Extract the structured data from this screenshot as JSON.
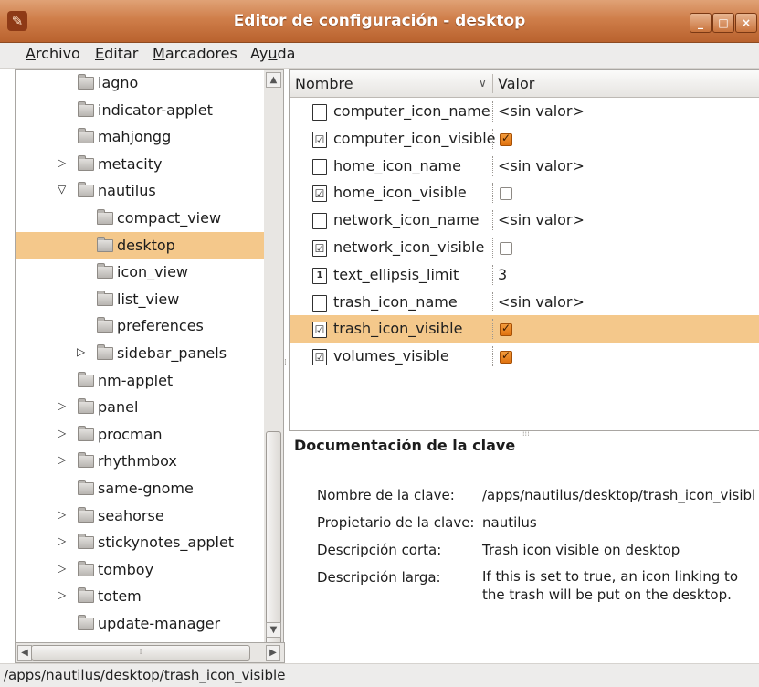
{
  "window": {
    "title": "Editor de configuración - desktop",
    "minimize": "_",
    "maximize": "□",
    "close": "×"
  },
  "menubar": [
    {
      "label": "Archivo",
      "mnemonic": "A",
      "rest": "rchivo"
    },
    {
      "label": "Editar",
      "mnemonic": "E",
      "rest": "ditar"
    },
    {
      "label": "Marcadores",
      "mnemonic": "M",
      "rest": "arcadores"
    },
    {
      "label": "Ayuda",
      "pre": "Ay",
      "mnemonic": "u",
      "rest": "da"
    }
  ],
  "tree": {
    "items": [
      {
        "label": "iagno",
        "expander": ""
      },
      {
        "label": "indicator-applet",
        "expander": ""
      },
      {
        "label": "mahjongg",
        "expander": ""
      },
      {
        "label": "metacity",
        "expander": "▷"
      },
      {
        "label": "nautilus",
        "expander": "▽"
      },
      {
        "label": "compact_view",
        "expander": ""
      },
      {
        "label": "desktop",
        "expander": ""
      },
      {
        "label": "icon_view",
        "expander": ""
      },
      {
        "label": "list_view",
        "expander": ""
      },
      {
        "label": "preferences",
        "expander": ""
      },
      {
        "label": "sidebar_panels",
        "expander": "▷"
      },
      {
        "label": "nm-applet",
        "expander": ""
      },
      {
        "label": "panel",
        "expander": "▷"
      },
      {
        "label": "procman",
        "expander": "▷"
      },
      {
        "label": "rhythmbox",
        "expander": "▷"
      },
      {
        "label": "same-gnome",
        "expander": ""
      },
      {
        "label": "seahorse",
        "expander": "▷"
      },
      {
        "label": "stickynotes_applet",
        "expander": "▷"
      },
      {
        "label": "tomboy",
        "expander": "▷"
      },
      {
        "label": "totem",
        "expander": "▷"
      },
      {
        "label": "update-manager",
        "expander": ""
      }
    ]
  },
  "keylist": {
    "col_name": "Nombre",
    "col_value": "Valor",
    "sort_indicator": "∨",
    "rows": [
      {
        "name": "computer_icon_name",
        "type": "string",
        "value": "<sin valor>"
      },
      {
        "name": "computer_icon_visible",
        "type": "bool",
        "checked": true
      },
      {
        "name": "home_icon_name",
        "type": "string",
        "value": "<sin valor>"
      },
      {
        "name": "home_icon_visible",
        "type": "bool",
        "checked": false
      },
      {
        "name": "network_icon_name",
        "type": "string",
        "value": "<sin valor>"
      },
      {
        "name": "network_icon_visible",
        "type": "bool",
        "checked": false
      },
      {
        "name": "text_ellipsis_limit",
        "type": "int",
        "value": "3",
        "icon_glyph": "1"
      },
      {
        "name": "trash_icon_name",
        "type": "string",
        "value": "<sin valor>"
      },
      {
        "name": "trash_icon_visible",
        "type": "bool",
        "checked": true
      },
      {
        "name": "volumes_visible",
        "type": "bool",
        "checked": true
      }
    ]
  },
  "doc": {
    "title": "Documentación de la clave",
    "key_name_label": "Nombre de la clave:",
    "key_name_value": "/apps/nautilus/desktop/trash_icon_visibl",
    "owner_label": "Propietario de la clave:",
    "owner_value": "nautilus",
    "short_desc_label": "Descripción corta:",
    "short_desc_value": "Trash icon visible on desktop",
    "long_desc_label": "Descripción larga:",
    "long_desc_value": "If this is set to true, an icon linking to the trash will be put on the desktop."
  },
  "statusbar": {
    "text": "/apps/nautilus/desktop/trash_icon_visible"
  }
}
